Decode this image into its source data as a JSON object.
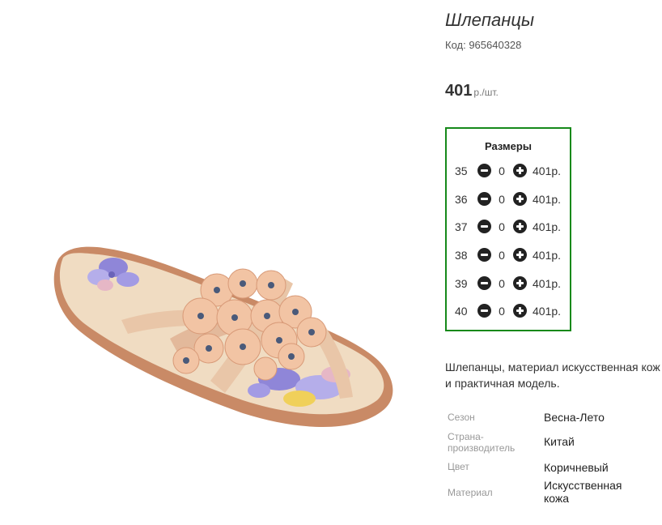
{
  "product": {
    "title": "Шлепанцы",
    "code_label": "Код: 965640328",
    "price_value": "401",
    "price_unit": "р./шт."
  },
  "sizes": {
    "title": "Размеры",
    "rows": [
      {
        "size": "35",
        "qty": "0",
        "price": "401р."
      },
      {
        "size": "36",
        "qty": "0",
        "price": "401р."
      },
      {
        "size": "37",
        "qty": "0",
        "price": "401р."
      },
      {
        "size": "38",
        "qty": "0",
        "price": "401р."
      },
      {
        "size": "39",
        "qty": "0",
        "price": "401р."
      },
      {
        "size": "40",
        "qty": "0",
        "price": "401р."
      }
    ]
  },
  "description": {
    "line1": "Шлепанцы, материал искусственная кож",
    "line2": "и практичная модель."
  },
  "specs": [
    {
      "key_line1": "Сезон",
      "key_line2": "",
      "value_line1": "Весна-Лето",
      "value_line2": ""
    },
    {
      "key_line1": "Страна-",
      "key_line2": "производитель",
      "value_line1": "Китай",
      "value_line2": ""
    },
    {
      "key_line1": "Цвет",
      "key_line2": "",
      "value_line1": "Коричневый",
      "value_line2": ""
    },
    {
      "key_line1": "Материал",
      "key_line2": "",
      "value_line1": "Искусственная",
      "value_line2": "кожа"
    }
  ],
  "icons": {
    "minus": "minus-circle-icon",
    "plus": "plus-circle-icon"
  },
  "colors": {
    "sizes_border": "#16891a",
    "button": "#222222"
  }
}
